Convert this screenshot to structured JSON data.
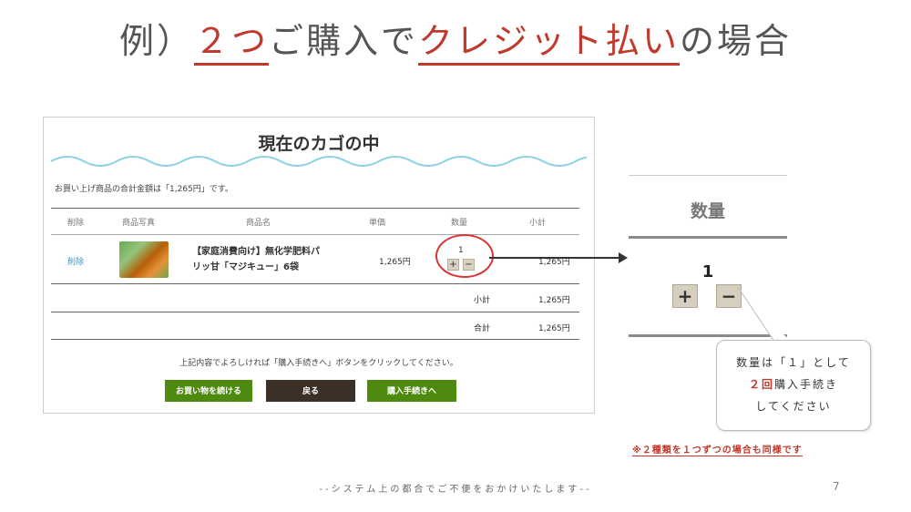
{
  "title": {
    "prefix": "例）",
    "emph1": "２つ",
    "mid": "ご購入で",
    "emph2": "クレジット払い",
    "suffix": "の場合"
  },
  "cart": {
    "heading": "現在のカゴの中",
    "total_note": "お買い上げ商品の合計金額は「1,265円」です。",
    "columns": [
      "削除",
      "商品写真",
      "商品名",
      "単価",
      "数量",
      "小計"
    ],
    "item": {
      "delete_label": "削除",
      "name_line1": "【家庭消費向け】無化学肥料パ",
      "name_line2": "リッ甘「マジキュー」6袋",
      "unit_price": "1,265円",
      "quantity": "1",
      "plus": "+",
      "minus": "−",
      "subtotal": "1,265円"
    },
    "subtotal_label": "小計",
    "subtotal_value": "1,265円",
    "total_label": "合計",
    "total_value": "1,265円",
    "note": "上記内容でよろしければ「購入手続きへ」ボタンをクリックしてください。",
    "buttons": {
      "continue": "お買い物を続ける",
      "back": "戻る",
      "checkout": "購入手続きへ"
    }
  },
  "zoom": {
    "header": "数量",
    "quantity": "1",
    "plus": "+",
    "minus": "−"
  },
  "bubble": {
    "line1": "数量は「１」として",
    "line2_red": "２回",
    "line2_rest": "購入手続き",
    "line3": "してください"
  },
  "footnote": "※２種類を１つずつの場合も同様です",
  "footer": "--システム上の都合でご不便をおかけいたします--",
  "page_number": "7",
  "colors": {
    "accent_red": "#c0392b",
    "green_button": "#4f8a10",
    "dark_button": "#3b2f26",
    "link_blue": "#3a9bc2",
    "wave_blue": "#8fd0e6"
  },
  "icons": {
    "plus": "plus-icon",
    "minus": "minus-icon",
    "arrow": "arrow-right-icon"
  }
}
